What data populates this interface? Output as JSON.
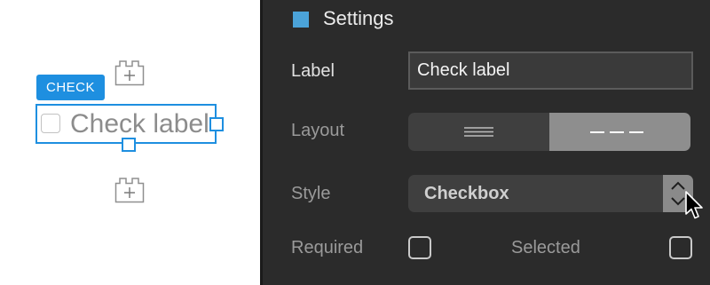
{
  "canvas": {
    "tag_label": "CHECK",
    "element_text": "Check label",
    "top_add_icon": "lego-plus-icon",
    "bottom_add_icon": "lego-plus-icon"
  },
  "panel": {
    "header": {
      "title": "Settings",
      "accent_color": "#4ba3d9"
    },
    "label": {
      "label": "Label",
      "value": "Check label"
    },
    "layout": {
      "label": "Layout",
      "options": [
        "stacked-lines-icon",
        "inline-dashes-icon"
      ],
      "selected": 1
    },
    "style": {
      "label": "Style",
      "value": "Checkbox"
    },
    "required": {
      "label": "Required",
      "checked": false
    },
    "selected": {
      "label": "Selected",
      "checked": false
    }
  },
  "colors": {
    "accent": "#1e8fe0",
    "panel_bg": "#2b2b2b",
    "segment_active": "#8e8e8e"
  }
}
